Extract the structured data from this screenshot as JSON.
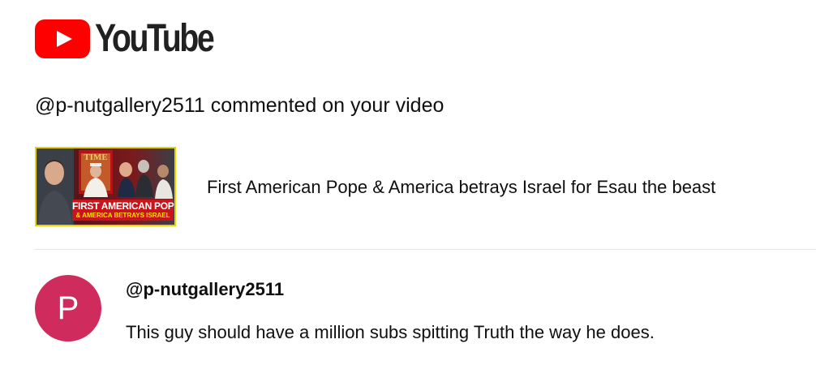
{
  "brand": {
    "logo_text": "YouTube",
    "logo_icon": "youtube-play-icon",
    "brand_color": "#ff0000"
  },
  "notification": {
    "headline": "@p-nutgallery2511 commented on your video"
  },
  "video": {
    "title": "First American Pope & America betrays Israel for Esau the beast",
    "thumbnail": {
      "caption_line1": "FIRST AMERICAN POPE",
      "caption_line2": "& AMERICA BETRAYS ISRAEL",
      "magazine_text": "TIME"
    }
  },
  "comment": {
    "avatar_letter": "P",
    "avatar_color": "#cf2b5c",
    "author": "@p-nutgallery2511",
    "text": "This guy should have a million subs spitting Truth the way he does."
  }
}
